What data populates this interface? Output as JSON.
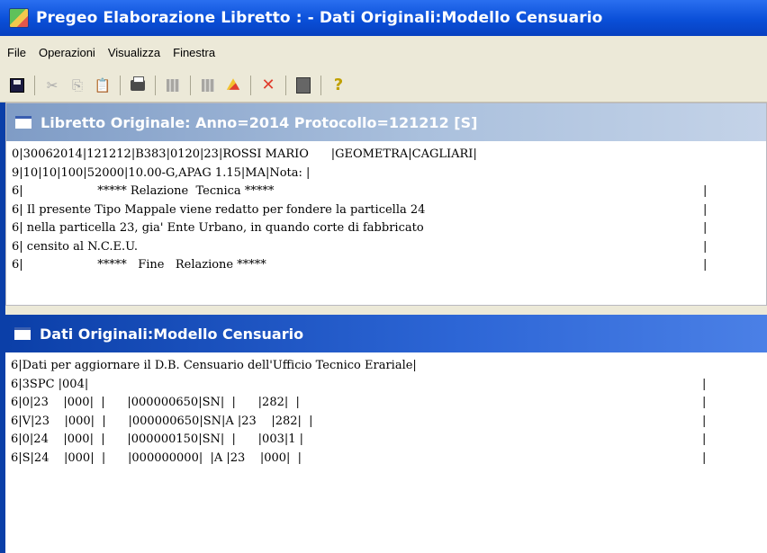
{
  "app": {
    "title": "Pregeo Elaborazione Libretto : -  Dati Originali:Modello Censuario"
  },
  "menubar": {
    "items": [
      "File",
      "Operazioni",
      "Visualizza",
      "Finestra"
    ]
  },
  "toolbar": {
    "icons": [
      "save-icon",
      "cut-icon",
      "copy-icon",
      "paste-icon",
      "print-icon",
      "grid-icon",
      "table-icon",
      "hat-icon",
      "x-icon",
      "calculator-icon",
      "help-icon"
    ]
  },
  "libretto_window": {
    "title": "Libretto Originale: Anno=2014 Protocollo=121212 [S]",
    "lines": [
      {
        "text": "0|30062014|121212|B383|0120|23|ROSSI MARIO      |GEOMETRA|CAGLIARI|",
        "end": ""
      },
      {
        "text": "9|10|10|100|52000|10.00-G,APAG 1.15|MA|Nota: |",
        "end": ""
      },
      {
        "text": "6|                    ***** Relazione  Tecnica *****",
        "end": "|"
      },
      {
        "text": "6| Il presente Tipo Mappale viene redatto per fondere la particella 24",
        "end": "|"
      },
      {
        "text": "6| nella particella 23, gia' Ente Urbano, in quando corte di fabbricato",
        "end": "|"
      },
      {
        "text": "6| censito al N.C.E.U.",
        "end": "|"
      },
      {
        "text": "6|                    *****   Fine   Relazione *****",
        "end": "|"
      }
    ]
  },
  "censuario_window": {
    "title": "Dati Originali:Modello Censuario",
    "lines": [
      {
        "text": "6|Dati per aggiornare il D.B. Censuario dell'Ufficio Tecnico Erariale|",
        "end": ""
      },
      {
        "text": "6|3SPC |004|",
        "end": "|"
      },
      {
        "text": "6|0|23    |000|  |      |000000650|SN|  |      |282|  |",
        "end": "|"
      },
      {
        "text": "6|V|23    |000|  |      |000000650|SN|A |23    |282|  |",
        "end": "|"
      },
      {
        "text": "6|0|24    |000|  |      |000000150|SN|  |      |003|1 |",
        "end": "|"
      },
      {
        "text": "6|S|24    |000|  |      |000000000|  |A |23    |000|  |",
        "end": "|"
      }
    ]
  }
}
